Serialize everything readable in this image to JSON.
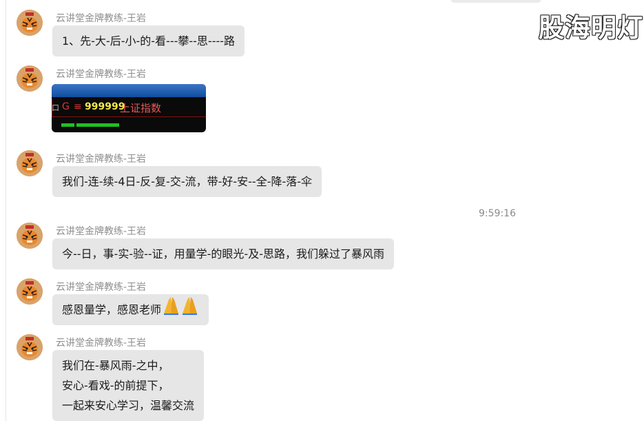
{
  "watermark": "股海明灯",
  "colors": {
    "bubble": "#e6e6e6",
    "sender": "#8e8e8e",
    "text": "#1a1a1a"
  },
  "messages": [
    {
      "sender": "云讲堂金牌教练-王岩",
      "lines": [
        "1、先-大-后-小-的-看---攀--思----路"
      ]
    },
    {
      "sender": "云讲堂金牌教练-王岩",
      "quote": {
        "flag": "G",
        "sep": "≡",
        "code": "999999",
        "name": "上证指数",
        "side": "口"
      }
    },
    {
      "sender": "云讲堂金牌教练-王岩",
      "lines": [
        "我们-连-续-4日-反-复-交-流，带-好-安--全-降-落-伞"
      ]
    },
    {
      "sender": "云讲堂金牌教练-王岩",
      "lines": [
        "今--日，事-实-验--证，用量学-的眼光-及-思路，我们躲过了暴风雨"
      ]
    },
    {
      "sender": "云讲堂金牌教练-王岩",
      "lines": [
        "感恩量学，感恩老师"
      ],
      "emoji": "folded-hands-icon"
    },
    {
      "sender": "云讲堂金牌教练-王岩",
      "lines": [
        "我们在-暴风雨-之中，",
        "安心-看戏-的前提下，",
        "一起来安心学习，温馨交流"
      ]
    }
  ],
  "timestamp": "9:59:16"
}
